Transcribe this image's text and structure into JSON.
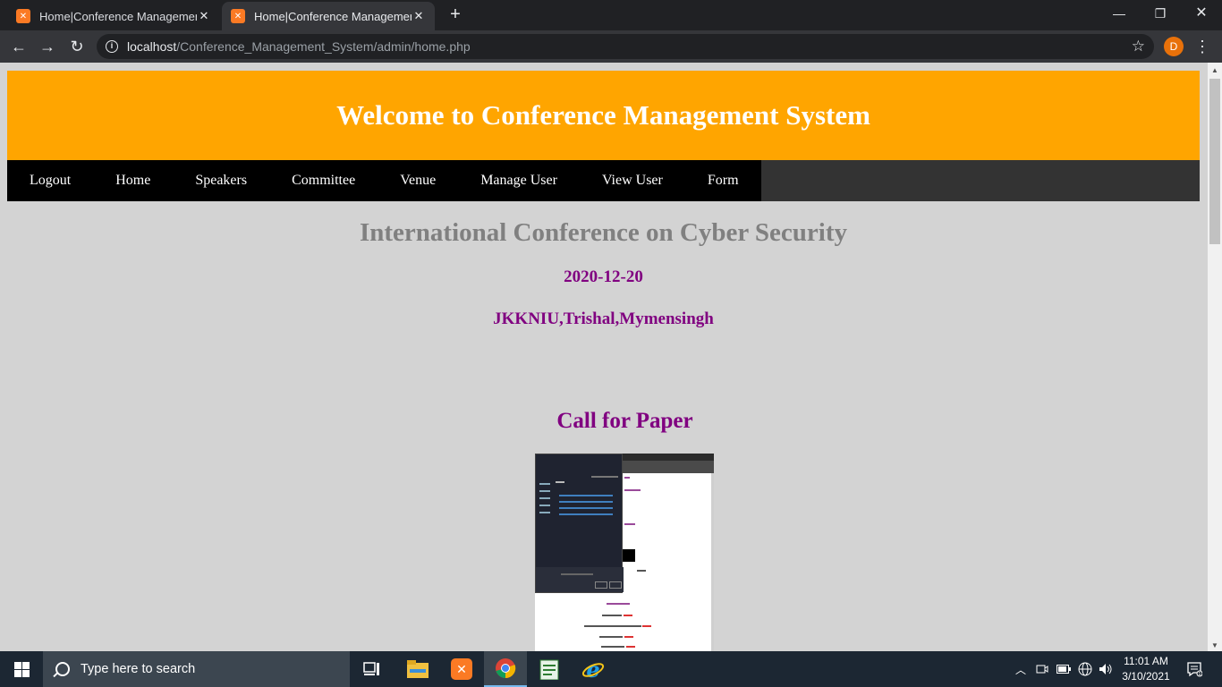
{
  "browser": {
    "tabs": [
      {
        "title": "Home|Conference Management"
      },
      {
        "title": "Home|Conference Management"
      }
    ],
    "url_host": "localhost",
    "url_path": "/Conference_Management_System/admin/home.php",
    "profile_initial": "D",
    "accent": "#e8710a"
  },
  "page": {
    "header_title": "Welcome to Conference Management System",
    "header_color": "#ffa500",
    "nav": [
      "Logout",
      "Home",
      "Speakers",
      "Committee",
      "Venue",
      "Manage User",
      "View User",
      "Form"
    ],
    "conference_title": "International Conference on Cyber Security",
    "conference_date": "2020-12-20",
    "conference_venue": "JKKNIU,Trishal,Mymensingh",
    "call_for_paper": "Call for Paper",
    "text_accent": "#800080"
  },
  "taskbar": {
    "search_placeholder": "Type here to search",
    "time": "11:01 AM",
    "date": "3/10/2021",
    "apps": [
      "task-view-icon",
      "file-explorer-icon",
      "xampp-icon",
      "chrome-icon",
      "notepad-icon",
      "internet-explorer-icon"
    ]
  }
}
